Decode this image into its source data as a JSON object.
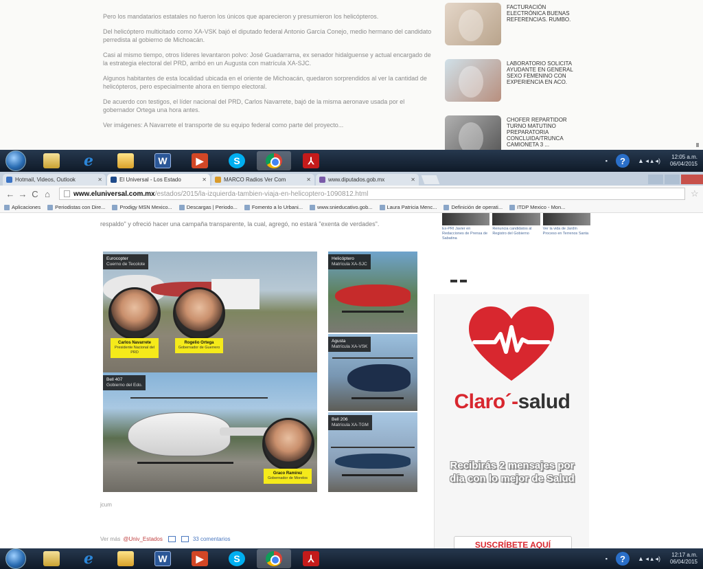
{
  "top_article": {
    "paragraphs": [
      "Pero los mandatarios estatales no fueron los únicos que aparecieron y presumieron los helicópteros.",
      "Del helicóptero multicitado como XA-VSK bajó el diputado federal Antonio García Conejo, medio hermano del candidato perredista al gobierno de Michoacán.",
      "Casi al mismo tiempo, otros líderes levantaron polvo: José Guadarrama, ex senador hidalguense y actual encargado de la estrategia electoral del PRD, arribó en un Augusta con matrícula XA-SJC.",
      "Algunos habitantes de esta localidad ubicada en el oriente de Michoacán, quedaron sorprendidos al ver la cantidad de helicópteros, pero especialmente ahora en tiempo electoral.",
      "De acuerdo con testigos, el líder nacional del PRD, Carlos Navarrete, bajó de la misma aeronave usada por el gobernador Ortega una hora antes.",
      "Ver imágenes: A Navarrete el transporte de su equipo federal como parte del proyecto..."
    ],
    "ads": [
      {
        "text": "Facturación electrónica buenas referencias. Rumbo."
      },
      {
        "text": "Laboratorio solicita ayudante en general sexo femenino con experiencia en ACO."
      },
      {
        "text": "Chofer repartidor turno matutino preparatoria concluida/trunca camioneta 3 ..."
      }
    ]
  },
  "taskbar": {
    "help": "?",
    "tray_arrows": "▲ ◂ ▴ ◂)",
    "clock_top": {
      "time": "12:05 a.m.",
      "date": "06/04/2015"
    },
    "clock_bottom": {
      "time": "12:17 a.m.",
      "date": "06/04/2015"
    }
  },
  "browser": {
    "tabs": [
      {
        "label": "Hotmail, Videos, Outlook",
        "color": "#3b73c4"
      },
      {
        "label": "El Universal - Los Estado",
        "color": "#1f4b8a",
        "active": true
      },
      {
        "label": "MARCO Radios Ver Com",
        "color": "#d99b2b"
      },
      {
        "label": "www.diputados.gob.mx",
        "color": "#7a5aa8"
      }
    ],
    "url_domain": "www.eluniversal.com.mx",
    "url_path": "/estados/2015/la-izquierda-tambien-viaja-en-helicoptero-1090812.html",
    "bookmarks": [
      "Aplicaciones",
      "Periodistas con Dire...",
      "Prodigy MSN Mexico...",
      "Descargas | Periodo...",
      "Fomento a lo Urbani...",
      "www.snieducativo.gob...",
      "Laura Patricia Menc...",
      "Definición de operati...",
      "ITDP Mexico - Mon..."
    ]
  },
  "article": {
    "intro": "respaldo\" y ofreció hacer una campaña transparente, la cual, agregó, no estará \"exenta de verdades\".",
    "photos": {
      "main": {
        "tag_title": "Eurocopter",
        "tag_sub": "Cuerno de Tecolote"
      },
      "bell": {
        "tag_title": "Bell 407",
        "tag_sub": "Gobierno del Edo."
      },
      "r1": {
        "tag_title": "Helicóptero",
        "tag_sub": "Matrícula XA-SJC"
      },
      "r2": {
        "tag_title": "Agusta",
        "tag_sub": "Matrícula XA-VSK"
      },
      "r3": {
        "tag_title": "Bell 206",
        "tag_sub": "Matrícula XA-TGM"
      }
    },
    "people": [
      {
        "name": "Carlos Navarrete",
        "role": "Presidente Nacional del PRD"
      },
      {
        "name": "Rogelio Ortega",
        "role": "Gobernador de Guerrero"
      },
      {
        "name": "Graco Ramírez",
        "role": "Gobernador de Morelos"
      }
    ],
    "caption": "jcum",
    "share_prefix": "Ver más",
    "handle": "@Univ_Estados",
    "comments": "33 comentarios"
  },
  "sidebar": {
    "related": [
      "Ex-PRI Javier en Redacciones de Prensa de Sabatina",
      "Renuncia candidatos al Registro del Gobierno",
      "Ver la vida de Jardín Proceso en Terrenos Santa"
    ],
    "ad": {
      "brand_claro": "Claro",
      "brand_salud": "salud",
      "promo": "Recibirás 2 mensajes por día con lo mejor de Salud",
      "cta": "SUSCRÍBETE AQUÍ",
      "accent": "#d8272f"
    }
  }
}
